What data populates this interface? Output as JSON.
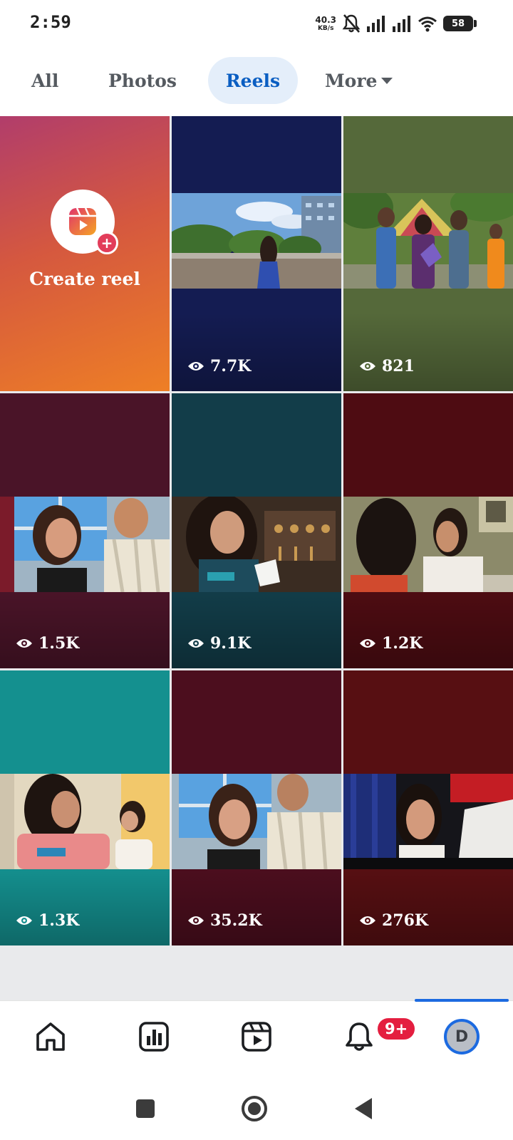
{
  "status_bar": {
    "time": "2:59",
    "net_speed_value": "40.3",
    "net_speed_unit": "KB/s",
    "battery": "58",
    "icons": [
      "bell-muted-icon",
      "signal-icon",
      "signal-icon",
      "wifi-icon",
      "battery-icon"
    ]
  },
  "tabs": {
    "all": "All",
    "photos": "Photos",
    "reels": "Reels",
    "more": "More",
    "active": "Reels"
  },
  "create_reel": {
    "label": "Create reel"
  },
  "reels": [
    {
      "views": "7.7K",
      "bg": "#141c52"
    },
    {
      "views": "821",
      "bg": "#55693a"
    },
    {
      "views": "1.5K",
      "bg": "#4a1428"
    },
    {
      "views": "9.1K",
      "bg": "#123d49"
    },
    {
      "views": "1.2K",
      "bg": "#4e0c12"
    },
    {
      "views": "1.3K",
      "bg": "#14908f"
    },
    {
      "views": "35.2K",
      "bg": "#4c0e1e"
    },
    {
      "views": "276K",
      "bg": "#570f12"
    }
  ],
  "bottom_nav": {
    "notifications_badge": "9+",
    "profile_initial": "D",
    "active": "profile"
  },
  "colors": {
    "accent": "#1c6ae0",
    "active_tab_bg": "#e4eefa",
    "active_tab_text": "#0a5ec2",
    "badge": "#e41e3f"
  }
}
